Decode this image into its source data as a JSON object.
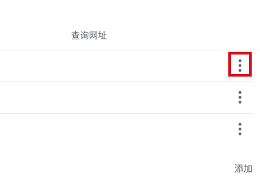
{
  "table": {
    "column_header": "查询网址",
    "rows": [
      {
        "menu_icon": "more-vert-icon",
        "highlighted": true
      },
      {
        "menu_icon": "more-vert-icon",
        "highlighted": false
      },
      {
        "menu_icon": "more-vert-icon",
        "highlighted": false
      }
    ]
  },
  "actions": {
    "add_label": "添加"
  },
  "colors": {
    "highlight": "#d4121d",
    "icon": "#5f6368",
    "divider": "#e8eaed"
  }
}
